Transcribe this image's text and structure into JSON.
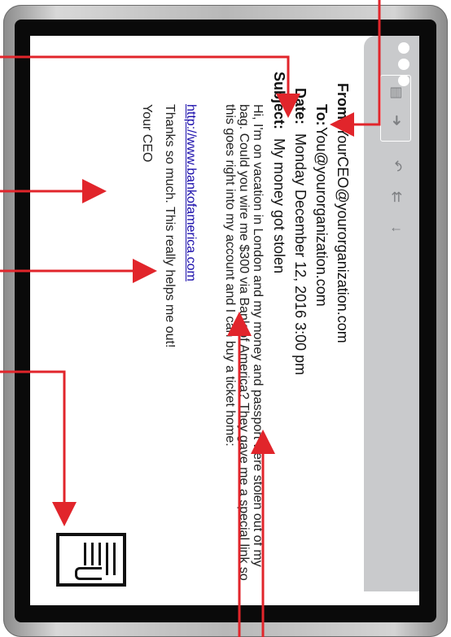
{
  "email": {
    "from_label": "From:",
    "from_value": "YourCEO@yourorganization.com",
    "to_label": "To:",
    "to_value": "You@yourorganization.com",
    "date_label": "Date:",
    "date_value": "Monday December 12, 2016 3:00 pm",
    "subject_label": "Subject:",
    "subject_value": "My money got stolen",
    "body": "Hi, I'm on vacation in London and my money and passport were stolen out of my bag. Could you wire me $300 via Bank of America? They gave me a special link so this goes right into my account and I can buy a ticket home:",
    "link": "http://www.bankofamerica.com",
    "thanks": "Thanks so much. This really helps me out!",
    "signature": "Your CEO"
  },
  "toolbar": {
    "icons": [
      "window-dots",
      "compose-icon",
      "forward-icon",
      "reply-icon",
      "reply-all-icon",
      "download-icon"
    ]
  },
  "colors": {
    "annotation_red": "#e1252b",
    "toolbar_gray": "#c9cacc",
    "link_blue": "#1a0dab"
  }
}
